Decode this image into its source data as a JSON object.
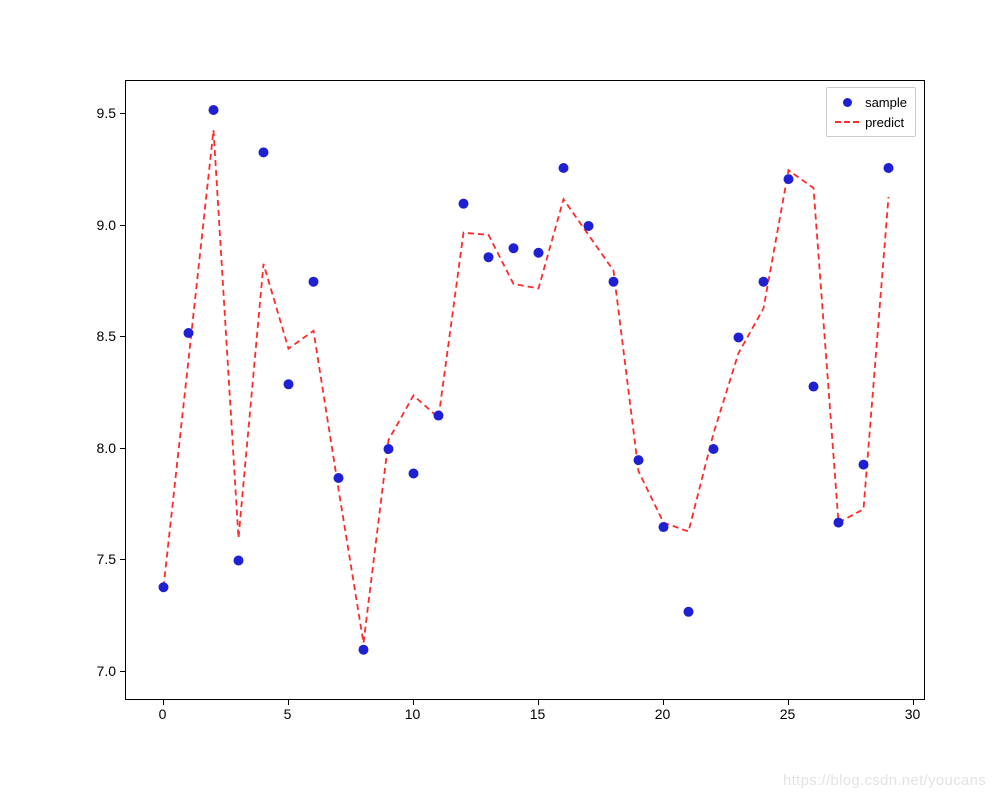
{
  "chart_data": {
    "type": "scatter",
    "xlabel": "",
    "ylabel": "",
    "title": "",
    "xlim": [
      -1.5,
      30.5
    ],
    "ylim": [
      6.87,
      9.65
    ],
    "x_ticks": [
      0,
      5,
      10,
      15,
      20,
      25,
      30
    ],
    "y_ticks": [
      7.0,
      7.5,
      8.0,
      8.5,
      9.0,
      9.5
    ],
    "series": [
      {
        "name": "sample",
        "kind": "scatter",
        "color": "#1f1fd4",
        "x": [
          0,
          1,
          2,
          3,
          4,
          5,
          6,
          7,
          8,
          9,
          10,
          11,
          12,
          13,
          14,
          15,
          16,
          17,
          18,
          19,
          20,
          21,
          22,
          23,
          24,
          25,
          26,
          27,
          28,
          29
        ],
        "y": [
          7.38,
          8.52,
          9.52,
          7.5,
          9.33,
          8.29,
          8.75,
          7.87,
          7.1,
          8.0,
          7.89,
          8.15,
          9.1,
          8.86,
          8.9,
          8.88,
          9.26,
          9.0,
          8.75,
          7.95,
          7.65,
          7.27,
          8.0,
          8.5,
          8.75,
          9.21,
          8.28,
          7.67,
          7.93,
          9.26
        ]
      },
      {
        "name": "predict",
        "kind": "dashed-line",
        "color": "#ff2a2a",
        "x": [
          0,
          1,
          2,
          3,
          4,
          5,
          6,
          7,
          8,
          9,
          10,
          11,
          12,
          13,
          14,
          15,
          16,
          17,
          18,
          19,
          20,
          21,
          22,
          23,
          24,
          25,
          26,
          27,
          28,
          29
        ],
        "y": [
          7.38,
          8.4,
          9.43,
          7.6,
          8.83,
          8.45,
          8.53,
          7.82,
          7.13,
          8.04,
          8.24,
          8.14,
          8.97,
          8.96,
          8.74,
          8.72,
          9.12,
          8.96,
          8.8,
          7.9,
          7.67,
          7.63,
          8.07,
          8.43,
          8.63,
          9.25,
          9.17,
          7.67,
          7.73,
          9.13
        ]
      }
    ],
    "legend": {
      "position": "upper-right",
      "items": [
        {
          "label": "sample",
          "kind": "dot",
          "color": "#1f1fd4"
        },
        {
          "label": "predict",
          "kind": "dash",
          "color": "#ff2a2a"
        }
      ]
    }
  },
  "legend_labels": {
    "sample": "sample",
    "predict": "predict"
  },
  "watermark": "https://blog.csdn.net/youcans"
}
